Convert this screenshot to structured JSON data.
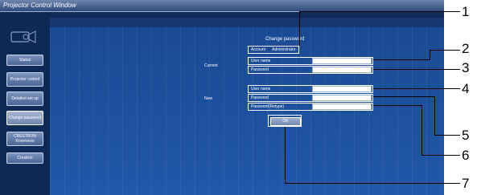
{
  "window": {
    "title": "Projector Control Window"
  },
  "sidebar": {
    "items": [
      {
        "label": "Status"
      },
      {
        "label": "Projector control"
      },
      {
        "label": "Detailed set up"
      },
      {
        "label": "Change password",
        "active": true
      },
      {
        "label": "CRESTRON Roomview"
      },
      {
        "label": "Crestron"
      }
    ]
  },
  "main": {
    "heading": "Change password",
    "tabs": [
      {
        "label": "Account"
      },
      {
        "label": "Administrator"
      }
    ],
    "current": {
      "section_label": "Current",
      "account_label": "User name",
      "password_label": "Password",
      "account_value": "",
      "password_value": ""
    },
    "new": {
      "section_label": "New",
      "account_label": "User name",
      "password_label": "Password",
      "retype_label": "Password(Retype)",
      "account_value": "",
      "password_value": "",
      "retype_value": ""
    },
    "ok_label": "OK"
  },
  "callouts": [
    "1",
    "2",
    "3",
    "4",
    "5",
    "6",
    "7"
  ],
  "colors": {
    "window_bg": "#0d2a57",
    "content_bg": "#1d4f9a",
    "highlight": "#ffffff",
    "callout": "#000000"
  }
}
